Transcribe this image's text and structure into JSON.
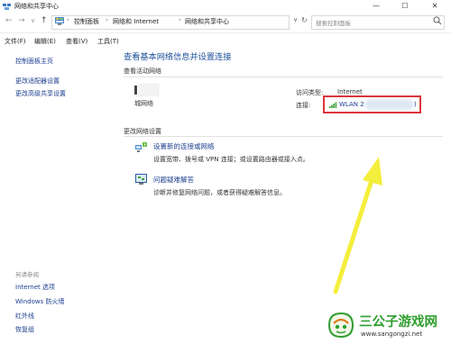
{
  "window": {
    "title": "网络和共享中心",
    "controls": {
      "minimize": "—",
      "maximize": "☐",
      "close": "✕"
    }
  },
  "address_bar": {
    "nav": {
      "back": "←",
      "forward": "→",
      "recent": "∨",
      "up": "↑"
    },
    "breadcrumbs": [
      "控制面板",
      "网络和 Internet",
      "网络和共享中心"
    ],
    "separator": "›",
    "dropdown": "∨",
    "refresh": "↻",
    "search_placeholder": "搜索控制面板"
  },
  "menu": {
    "items": [
      "文件(F)",
      "编辑(E)",
      "查看(V)",
      "工具(T)"
    ]
  },
  "sidebar": {
    "items": [
      "控制面板主页",
      "更改适配器设置",
      "更改高级共享设置"
    ],
    "see_also_heading": "另请参阅",
    "see_also": [
      "Internet 选项",
      "Windows 防火墙",
      "红外线",
      "恢复组"
    ]
  },
  "main": {
    "title": "查看基本网络信息并设置连接",
    "active_networks_heading": "查看活动网络",
    "network_name": "城网络",
    "access_type_label": "访问类型:",
    "access_type_value": "Internet",
    "connections_label": "连接:",
    "connection_link": "WLAN 2",
    "connection_link_tail": ")",
    "change_heading": "更改网络设置",
    "tasks": [
      {
        "title": "设置新的连接或网络",
        "desc": "设置宽带、拨号或 VPN 连接；或设置路由器或接入点。",
        "icon": "network-setup-icon"
      },
      {
        "title": "问题疑难解答",
        "desc": "诊断并修复网络问题，或者获得疑难解答信息。",
        "icon": "troubleshoot-icon"
      }
    ]
  },
  "watermark": {
    "name": "三公子游戏网",
    "url": "www.sangongzi.net"
  },
  "colors": {
    "link": "#1b3d8f",
    "title": "#1c4e9a",
    "highlight": "#d9353b",
    "arrow": "#f4ee3c",
    "watermark_green": "#2f9e2f"
  }
}
